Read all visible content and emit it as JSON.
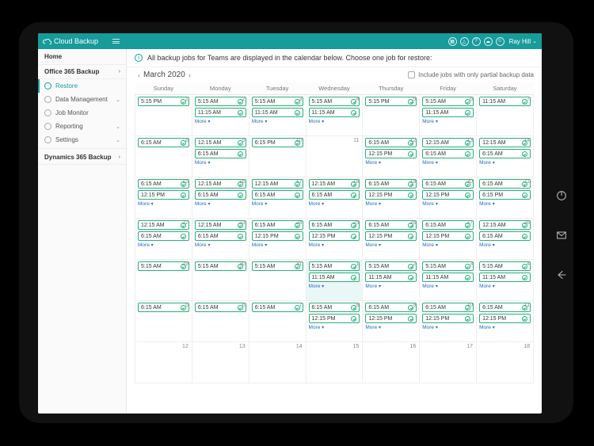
{
  "app": {
    "name": "Cloud Backup",
    "user": "Ray Hill"
  },
  "sidebar": {
    "home": "Home",
    "sections": [
      {
        "label": "Office 365 Backup",
        "items": [
          {
            "label": "Restore",
            "active": true
          },
          {
            "label": "Data Management",
            "caret": "down"
          },
          {
            "label": "Job Monitor"
          },
          {
            "label": "Reporting",
            "caret": "down"
          },
          {
            "label": "Settings",
            "caret": "down"
          }
        ]
      },
      {
        "label": "Dynamics 365 Backup"
      }
    ]
  },
  "info_text": "All backup jobs for Teams are displayed in the calendar below. Choose one job for restore:",
  "month_label": "March 2020",
  "partial_checkbox_label": "Include jobs with only partial backup data",
  "more_label": "More",
  "day_headers": [
    "Sunday",
    "Monday",
    "Tuesday",
    "Wednesday",
    "Thursday",
    "Friday",
    "Saturday"
  ],
  "weeks": [
    [
      {
        "n": 1,
        "chips": [
          "5:15 PM"
        ]
      },
      {
        "n": 2,
        "chips": [
          "5:15 AM",
          "11:15 AM"
        ],
        "more": true
      },
      {
        "n": 3,
        "chips": [
          "5:15 AM",
          "11:15 AM"
        ],
        "more": true
      },
      {
        "n": 4,
        "chips": [
          "5:15 AM",
          "11:15 AM"
        ],
        "more": true
      },
      {
        "n": 5,
        "chips": [
          "5:15 PM"
        ]
      },
      {
        "n": 6,
        "chips": [
          "5:15 AM",
          "11:15 AM"
        ],
        "more": true
      },
      {
        "n": 7,
        "chips": [
          "11:15 AM"
        ]
      }
    ],
    [
      {
        "n": 8,
        "chips": [
          "6:15 AM"
        ]
      },
      {
        "n": 9,
        "chips": [
          "12:15 AM",
          "6:15 AM"
        ],
        "more": true
      },
      {
        "n": 10,
        "chips": [
          "6:15 PM"
        ]
      },
      {
        "n": 11,
        "chips": []
      },
      {
        "n": 12,
        "chips": [
          "6:15 AM",
          "12:15 PM"
        ],
        "more": true
      },
      {
        "n": 13,
        "chips": [
          "12:15 AM",
          "6:15 AM"
        ],
        "more": true
      },
      {
        "n": 14,
        "chips": [
          "12:15 AM",
          "6:15 AM"
        ],
        "more": true
      }
    ],
    [
      {
        "n": 15,
        "chips": [
          "6:15 AM",
          "12:15 PM"
        ],
        "more": true
      },
      {
        "n": 16,
        "chips": [
          "12:15 AM",
          "6:15 AM"
        ],
        "more": true
      },
      {
        "n": 17,
        "chips": [
          "12:15 AM",
          "6:15 AM"
        ],
        "more": true
      },
      {
        "n": 18,
        "chips": [
          "12:15 AM",
          "6:15 AM"
        ],
        "more": true
      },
      {
        "n": 19,
        "chips": [
          "6:15 AM",
          "12:15 PM"
        ],
        "more": true
      },
      {
        "n": 20,
        "chips": [
          "6:15 AM",
          "12:15 PM"
        ],
        "more": true
      },
      {
        "n": 21,
        "chips": [
          "6:15 AM",
          "6:15 PM"
        ],
        "more": true
      }
    ],
    [
      {
        "n": 22,
        "chips": [
          "12:15 AM",
          "6:15 AM"
        ],
        "more": true
      },
      {
        "n": 23,
        "chips": [
          "12:15 AM",
          "6:15 AM"
        ],
        "more": true
      },
      {
        "n": 24,
        "chips": [
          "6:15 AM",
          "12:15 PM"
        ],
        "more": true
      },
      {
        "n": 25,
        "chips": [
          "6:15 AM",
          "12:15 PM"
        ],
        "more": true
      },
      {
        "n": 26,
        "chips": [
          "6:15 AM",
          "12:15 PM"
        ],
        "more": true
      },
      {
        "n": 27,
        "chips": [
          "6:15 AM",
          "12:15 PM"
        ],
        "more": true
      },
      {
        "n": 28,
        "chips": [
          "12:15 AM",
          "6:15 AM"
        ],
        "more": true
      }
    ],
    [
      {
        "n": 29,
        "chips": [
          "5:15 AM"
        ]
      },
      {
        "n": 30,
        "chips": [
          "5:15 AM"
        ]
      },
      {
        "n": 31,
        "chips": [
          "5:15 AM"
        ]
      },
      {
        "n": 1,
        "today": true,
        "chips": [
          "5:15 AM",
          "11:15 AM"
        ],
        "more": true
      },
      {
        "n": 2,
        "chips": [
          "5:15 AM",
          "11:15 AM"
        ],
        "more": true
      },
      {
        "n": 3,
        "chips": [
          "5:15 AM",
          "11:15 AM"
        ],
        "more": true
      },
      {
        "n": 4,
        "chips": [
          "5:15 AM",
          "11:15 AM"
        ],
        "more": true
      }
    ],
    [
      {
        "n": 5,
        "chips": [
          "6:15 AM"
        ]
      },
      {
        "n": 6,
        "chips": [
          "6:15 AM"
        ]
      },
      {
        "n": 7,
        "chips": [
          "6:15 AM"
        ]
      },
      {
        "n": 8,
        "chips": [
          "6:15 AM",
          "12:15 PM"
        ],
        "more": true
      },
      {
        "n": 9,
        "chips": [
          "6:15 AM",
          "12:15 PM"
        ],
        "more": true
      },
      {
        "n": 10,
        "chips": [
          "6:15 AM",
          "12:15 PM"
        ],
        "more": true
      },
      {
        "n": 11,
        "chips": [
          "6:15 AM",
          "12:15 PM"
        ],
        "more": true
      }
    ],
    [
      {
        "n": 12,
        "chips": []
      },
      {
        "n": 13,
        "chips": []
      },
      {
        "n": 14,
        "chips": []
      },
      {
        "n": 15,
        "chips": []
      },
      {
        "n": 16,
        "chips": []
      },
      {
        "n": 17,
        "chips": []
      },
      {
        "n": 18,
        "chips": []
      }
    ]
  ]
}
